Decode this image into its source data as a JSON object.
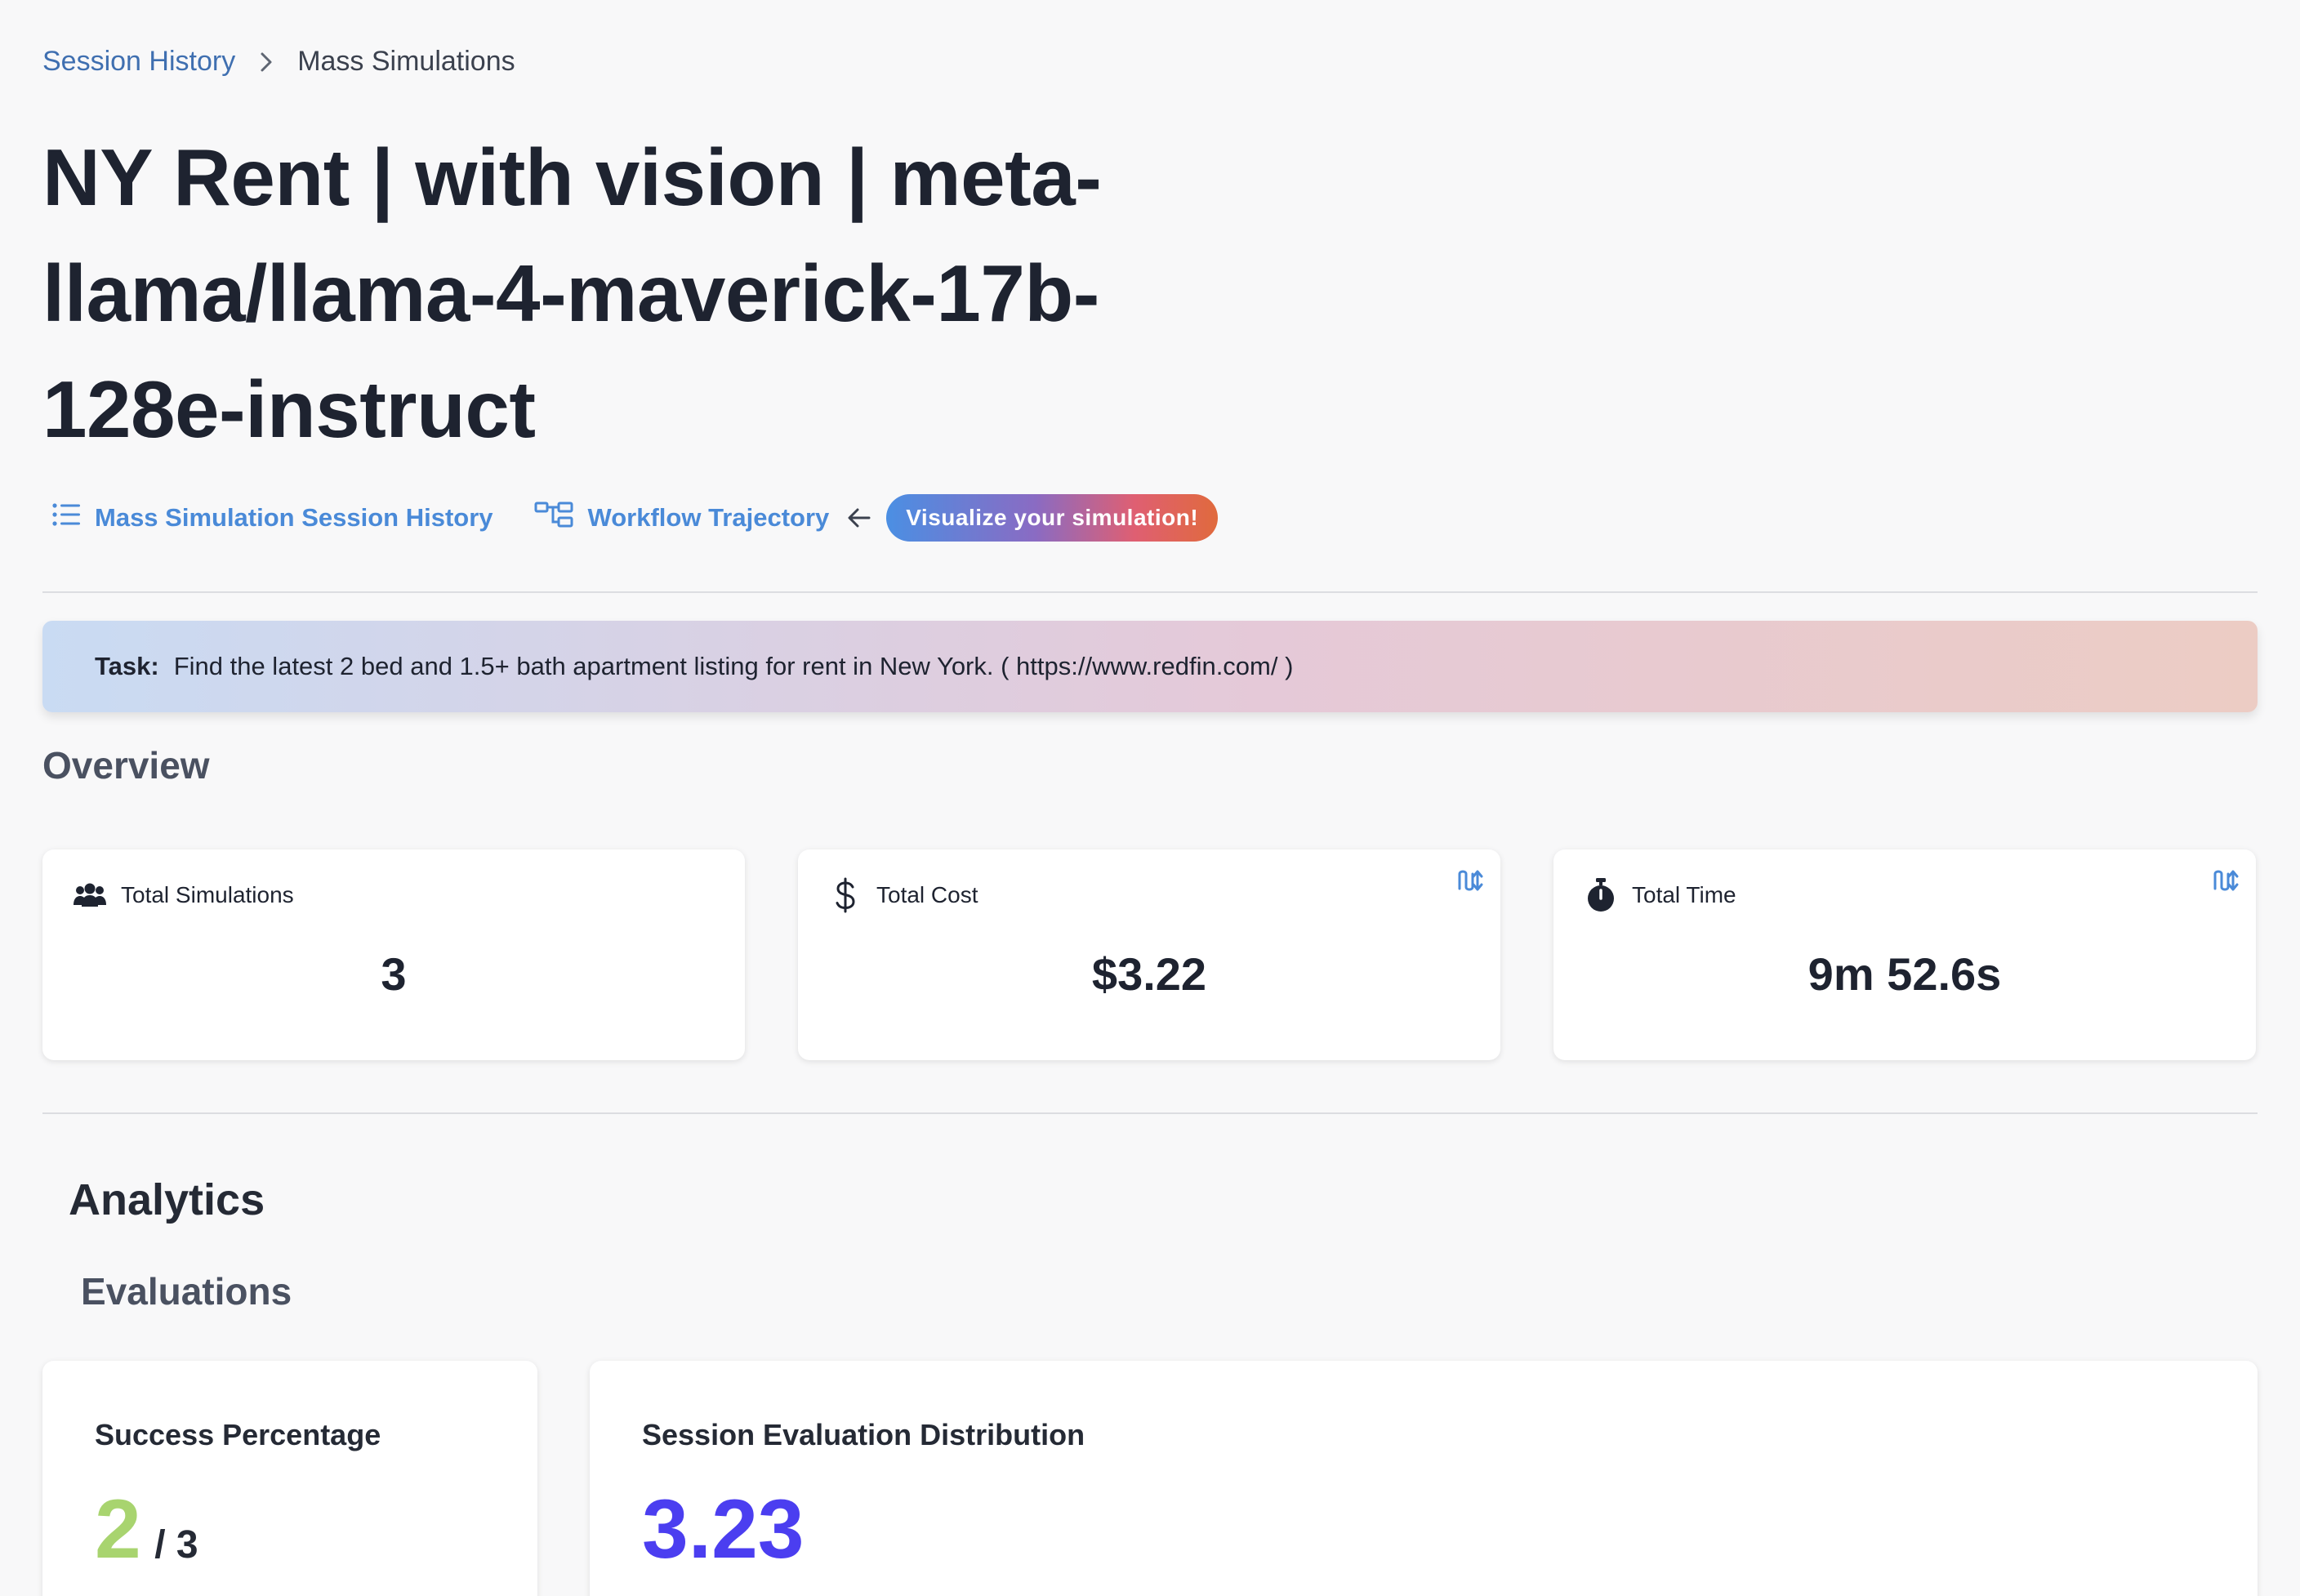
{
  "breadcrumb": {
    "parent": "Session History",
    "current": "Mass Simulations"
  },
  "title": "NY Rent | with vision | meta-llama/llama-4-maverick-17b-128e-instruct",
  "links": {
    "session_history": "Mass Simulation Session History",
    "workflow": "Workflow Trajectory",
    "visualize": "Visualize your simulation!"
  },
  "task": {
    "label": "Task:",
    "text": "Find the latest 2 bed and 1.5+ bath apartment listing for rent in New York. ( https://www.redfin.com/ )"
  },
  "overview": {
    "heading": "Overview",
    "stats": [
      {
        "label": "Total Simulations",
        "value": "3",
        "icon": "users-icon"
      },
      {
        "label": "Total Cost",
        "value": "$3.22",
        "icon": "dollar-icon"
      },
      {
        "label": "Total Time",
        "value": "9m 52.6s",
        "icon": "stopwatch-icon"
      }
    ]
  },
  "analytics": {
    "heading": "Analytics",
    "evaluations_heading": "Evaluations",
    "success": {
      "title": "Success Percentage",
      "value": "2",
      "total": "/ 3"
    },
    "distribution": {
      "title": "Session Evaluation Distribution",
      "value": "3.23"
    }
  },
  "colors": {
    "link": "#4a8ad8",
    "success": "#a8d46f",
    "distribution": "#4b3ef0"
  }
}
